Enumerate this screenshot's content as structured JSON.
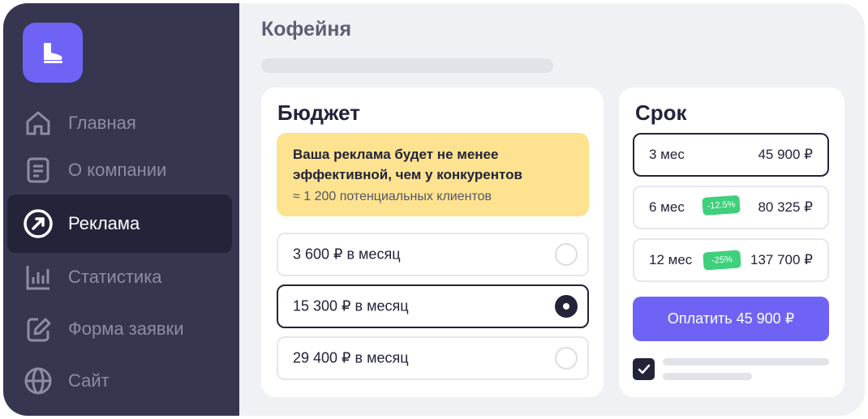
{
  "sidebar": {
    "logo_icon": "boot-icon",
    "items": [
      {
        "label": "Главная",
        "icon": "home-icon",
        "active": false
      },
      {
        "label": "О компании",
        "icon": "document-icon",
        "active": false
      },
      {
        "label": "Реклама",
        "icon": "arrow-circle-icon",
        "active": true
      },
      {
        "label": "Статистика",
        "icon": "bar-chart-icon",
        "active": false
      },
      {
        "label": "Форма заявки",
        "icon": "edit-icon",
        "active": false
      },
      {
        "label": "Сайт",
        "icon": "globe-icon",
        "active": false
      }
    ]
  },
  "page": {
    "title": "Кофейня"
  },
  "budget": {
    "title": "Бюджет",
    "promo_text": "Ваша реклама будет не менее эффективной, чем у конкурентов",
    "promo_sub": "≈ 1 200 потенциальных клиентов",
    "options": [
      {
        "label": "3 600 ₽ в месяц",
        "selected": false
      },
      {
        "label": "15 300 ₽ в месяц",
        "selected": true
      },
      {
        "label": "29 400 ₽ в месяц",
        "selected": false
      }
    ]
  },
  "term": {
    "title": "Срок",
    "options": [
      {
        "label": "3 мес",
        "price": "45 900 ₽",
        "discount": "",
        "selected": true
      },
      {
        "label": "6 мес",
        "price": "80 325 ₽",
        "discount": "-12.5%",
        "selected": false
      },
      {
        "label": "12 мес",
        "price": "137 700 ₽",
        "discount": "-25%",
        "selected": false
      }
    ],
    "pay_label": "Оплатить 45 900 ₽",
    "agree_checked": true
  },
  "colors": {
    "sidebar": "#363651",
    "sidebar_active": "#23233a",
    "accent": "#6f63f6",
    "promo": "#fde38f",
    "discount": "#3ed07c"
  }
}
